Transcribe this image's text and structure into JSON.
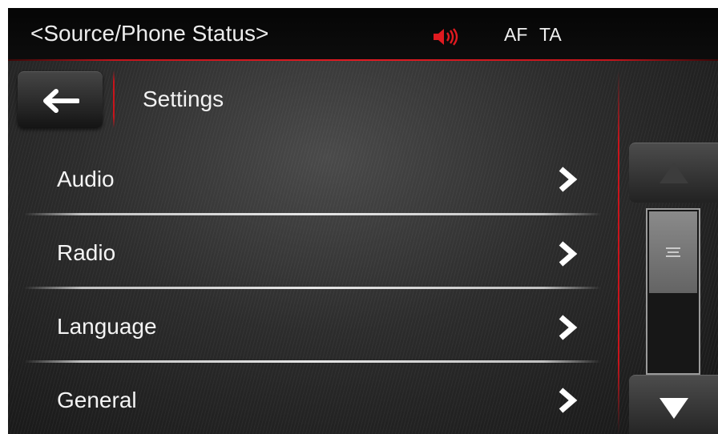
{
  "status_bar": {
    "source_status": "<Source/Phone Status>",
    "mute_icon": "speaker-muted-icon",
    "af_label": "AF",
    "ta_label": "TA",
    "accent_color": "#e11b22"
  },
  "header": {
    "back_icon": "arrow-left-icon",
    "title": "Settings"
  },
  "menu": {
    "items": [
      {
        "label": "Audio",
        "icon": "chevron-right-icon"
      },
      {
        "label": "Radio",
        "icon": "chevron-right-icon"
      },
      {
        "label": "Language",
        "icon": "chevron-right-icon"
      },
      {
        "label": "General",
        "icon": "chevron-right-icon"
      }
    ]
  },
  "scroll": {
    "up_icon": "triangle-up-icon",
    "down_icon": "triangle-down-icon",
    "up_enabled": false,
    "down_enabled": true,
    "thumb_fraction": 0.52,
    "thumb_position": 0
  }
}
